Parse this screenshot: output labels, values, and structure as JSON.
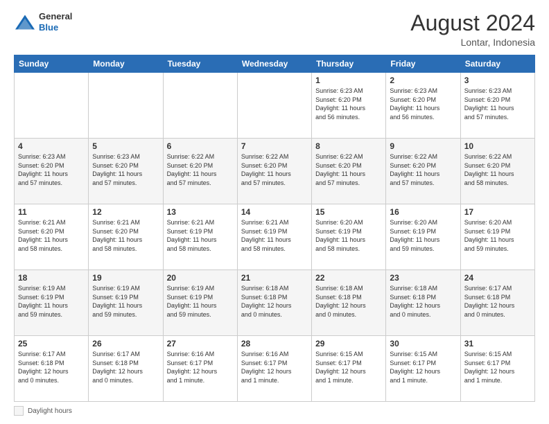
{
  "header": {
    "logo_line1": "General",
    "logo_line2": "Blue",
    "month_title": "August 2024",
    "location": "Lontar, Indonesia"
  },
  "footer": {
    "daylight_label": "Daylight hours"
  },
  "weekdays": [
    "Sunday",
    "Monday",
    "Tuesday",
    "Wednesday",
    "Thursday",
    "Friday",
    "Saturday"
  ],
  "weeks": [
    [
      {
        "day": "",
        "info": ""
      },
      {
        "day": "",
        "info": ""
      },
      {
        "day": "",
        "info": ""
      },
      {
        "day": "",
        "info": ""
      },
      {
        "day": "1",
        "info": "Sunrise: 6:23 AM\nSunset: 6:20 PM\nDaylight: 11 hours\nand 56 minutes."
      },
      {
        "day": "2",
        "info": "Sunrise: 6:23 AM\nSunset: 6:20 PM\nDaylight: 11 hours\nand 56 minutes."
      },
      {
        "day": "3",
        "info": "Sunrise: 6:23 AM\nSunset: 6:20 PM\nDaylight: 11 hours\nand 57 minutes."
      }
    ],
    [
      {
        "day": "4",
        "info": "Sunrise: 6:23 AM\nSunset: 6:20 PM\nDaylight: 11 hours\nand 57 minutes."
      },
      {
        "day": "5",
        "info": "Sunrise: 6:23 AM\nSunset: 6:20 PM\nDaylight: 11 hours\nand 57 minutes."
      },
      {
        "day": "6",
        "info": "Sunrise: 6:22 AM\nSunset: 6:20 PM\nDaylight: 11 hours\nand 57 minutes."
      },
      {
        "day": "7",
        "info": "Sunrise: 6:22 AM\nSunset: 6:20 PM\nDaylight: 11 hours\nand 57 minutes."
      },
      {
        "day": "8",
        "info": "Sunrise: 6:22 AM\nSunset: 6:20 PM\nDaylight: 11 hours\nand 57 minutes."
      },
      {
        "day": "9",
        "info": "Sunrise: 6:22 AM\nSunset: 6:20 PM\nDaylight: 11 hours\nand 57 minutes."
      },
      {
        "day": "10",
        "info": "Sunrise: 6:22 AM\nSunset: 6:20 PM\nDaylight: 11 hours\nand 58 minutes."
      }
    ],
    [
      {
        "day": "11",
        "info": "Sunrise: 6:21 AM\nSunset: 6:20 PM\nDaylight: 11 hours\nand 58 minutes."
      },
      {
        "day": "12",
        "info": "Sunrise: 6:21 AM\nSunset: 6:20 PM\nDaylight: 11 hours\nand 58 minutes."
      },
      {
        "day": "13",
        "info": "Sunrise: 6:21 AM\nSunset: 6:19 PM\nDaylight: 11 hours\nand 58 minutes."
      },
      {
        "day": "14",
        "info": "Sunrise: 6:21 AM\nSunset: 6:19 PM\nDaylight: 11 hours\nand 58 minutes."
      },
      {
        "day": "15",
        "info": "Sunrise: 6:20 AM\nSunset: 6:19 PM\nDaylight: 11 hours\nand 58 minutes."
      },
      {
        "day": "16",
        "info": "Sunrise: 6:20 AM\nSunset: 6:19 PM\nDaylight: 11 hours\nand 59 minutes."
      },
      {
        "day": "17",
        "info": "Sunrise: 6:20 AM\nSunset: 6:19 PM\nDaylight: 11 hours\nand 59 minutes."
      }
    ],
    [
      {
        "day": "18",
        "info": "Sunrise: 6:19 AM\nSunset: 6:19 PM\nDaylight: 11 hours\nand 59 minutes."
      },
      {
        "day": "19",
        "info": "Sunrise: 6:19 AM\nSunset: 6:19 PM\nDaylight: 11 hours\nand 59 minutes."
      },
      {
        "day": "20",
        "info": "Sunrise: 6:19 AM\nSunset: 6:19 PM\nDaylight: 11 hours\nand 59 minutes."
      },
      {
        "day": "21",
        "info": "Sunrise: 6:18 AM\nSunset: 6:18 PM\nDaylight: 12 hours\nand 0 minutes."
      },
      {
        "day": "22",
        "info": "Sunrise: 6:18 AM\nSunset: 6:18 PM\nDaylight: 12 hours\nand 0 minutes."
      },
      {
        "day": "23",
        "info": "Sunrise: 6:18 AM\nSunset: 6:18 PM\nDaylight: 12 hours\nand 0 minutes."
      },
      {
        "day": "24",
        "info": "Sunrise: 6:17 AM\nSunset: 6:18 PM\nDaylight: 12 hours\nand 0 minutes."
      }
    ],
    [
      {
        "day": "25",
        "info": "Sunrise: 6:17 AM\nSunset: 6:18 PM\nDaylight: 12 hours\nand 0 minutes."
      },
      {
        "day": "26",
        "info": "Sunrise: 6:17 AM\nSunset: 6:18 PM\nDaylight: 12 hours\nand 0 minutes."
      },
      {
        "day": "27",
        "info": "Sunrise: 6:16 AM\nSunset: 6:17 PM\nDaylight: 12 hours\nand 1 minute."
      },
      {
        "day": "28",
        "info": "Sunrise: 6:16 AM\nSunset: 6:17 PM\nDaylight: 12 hours\nand 1 minute."
      },
      {
        "day": "29",
        "info": "Sunrise: 6:15 AM\nSunset: 6:17 PM\nDaylight: 12 hours\nand 1 minute."
      },
      {
        "day": "30",
        "info": "Sunrise: 6:15 AM\nSunset: 6:17 PM\nDaylight: 12 hours\nand 1 minute."
      },
      {
        "day": "31",
        "info": "Sunrise: 6:15 AM\nSunset: 6:17 PM\nDaylight: 12 hours\nand 1 minute."
      }
    ]
  ]
}
